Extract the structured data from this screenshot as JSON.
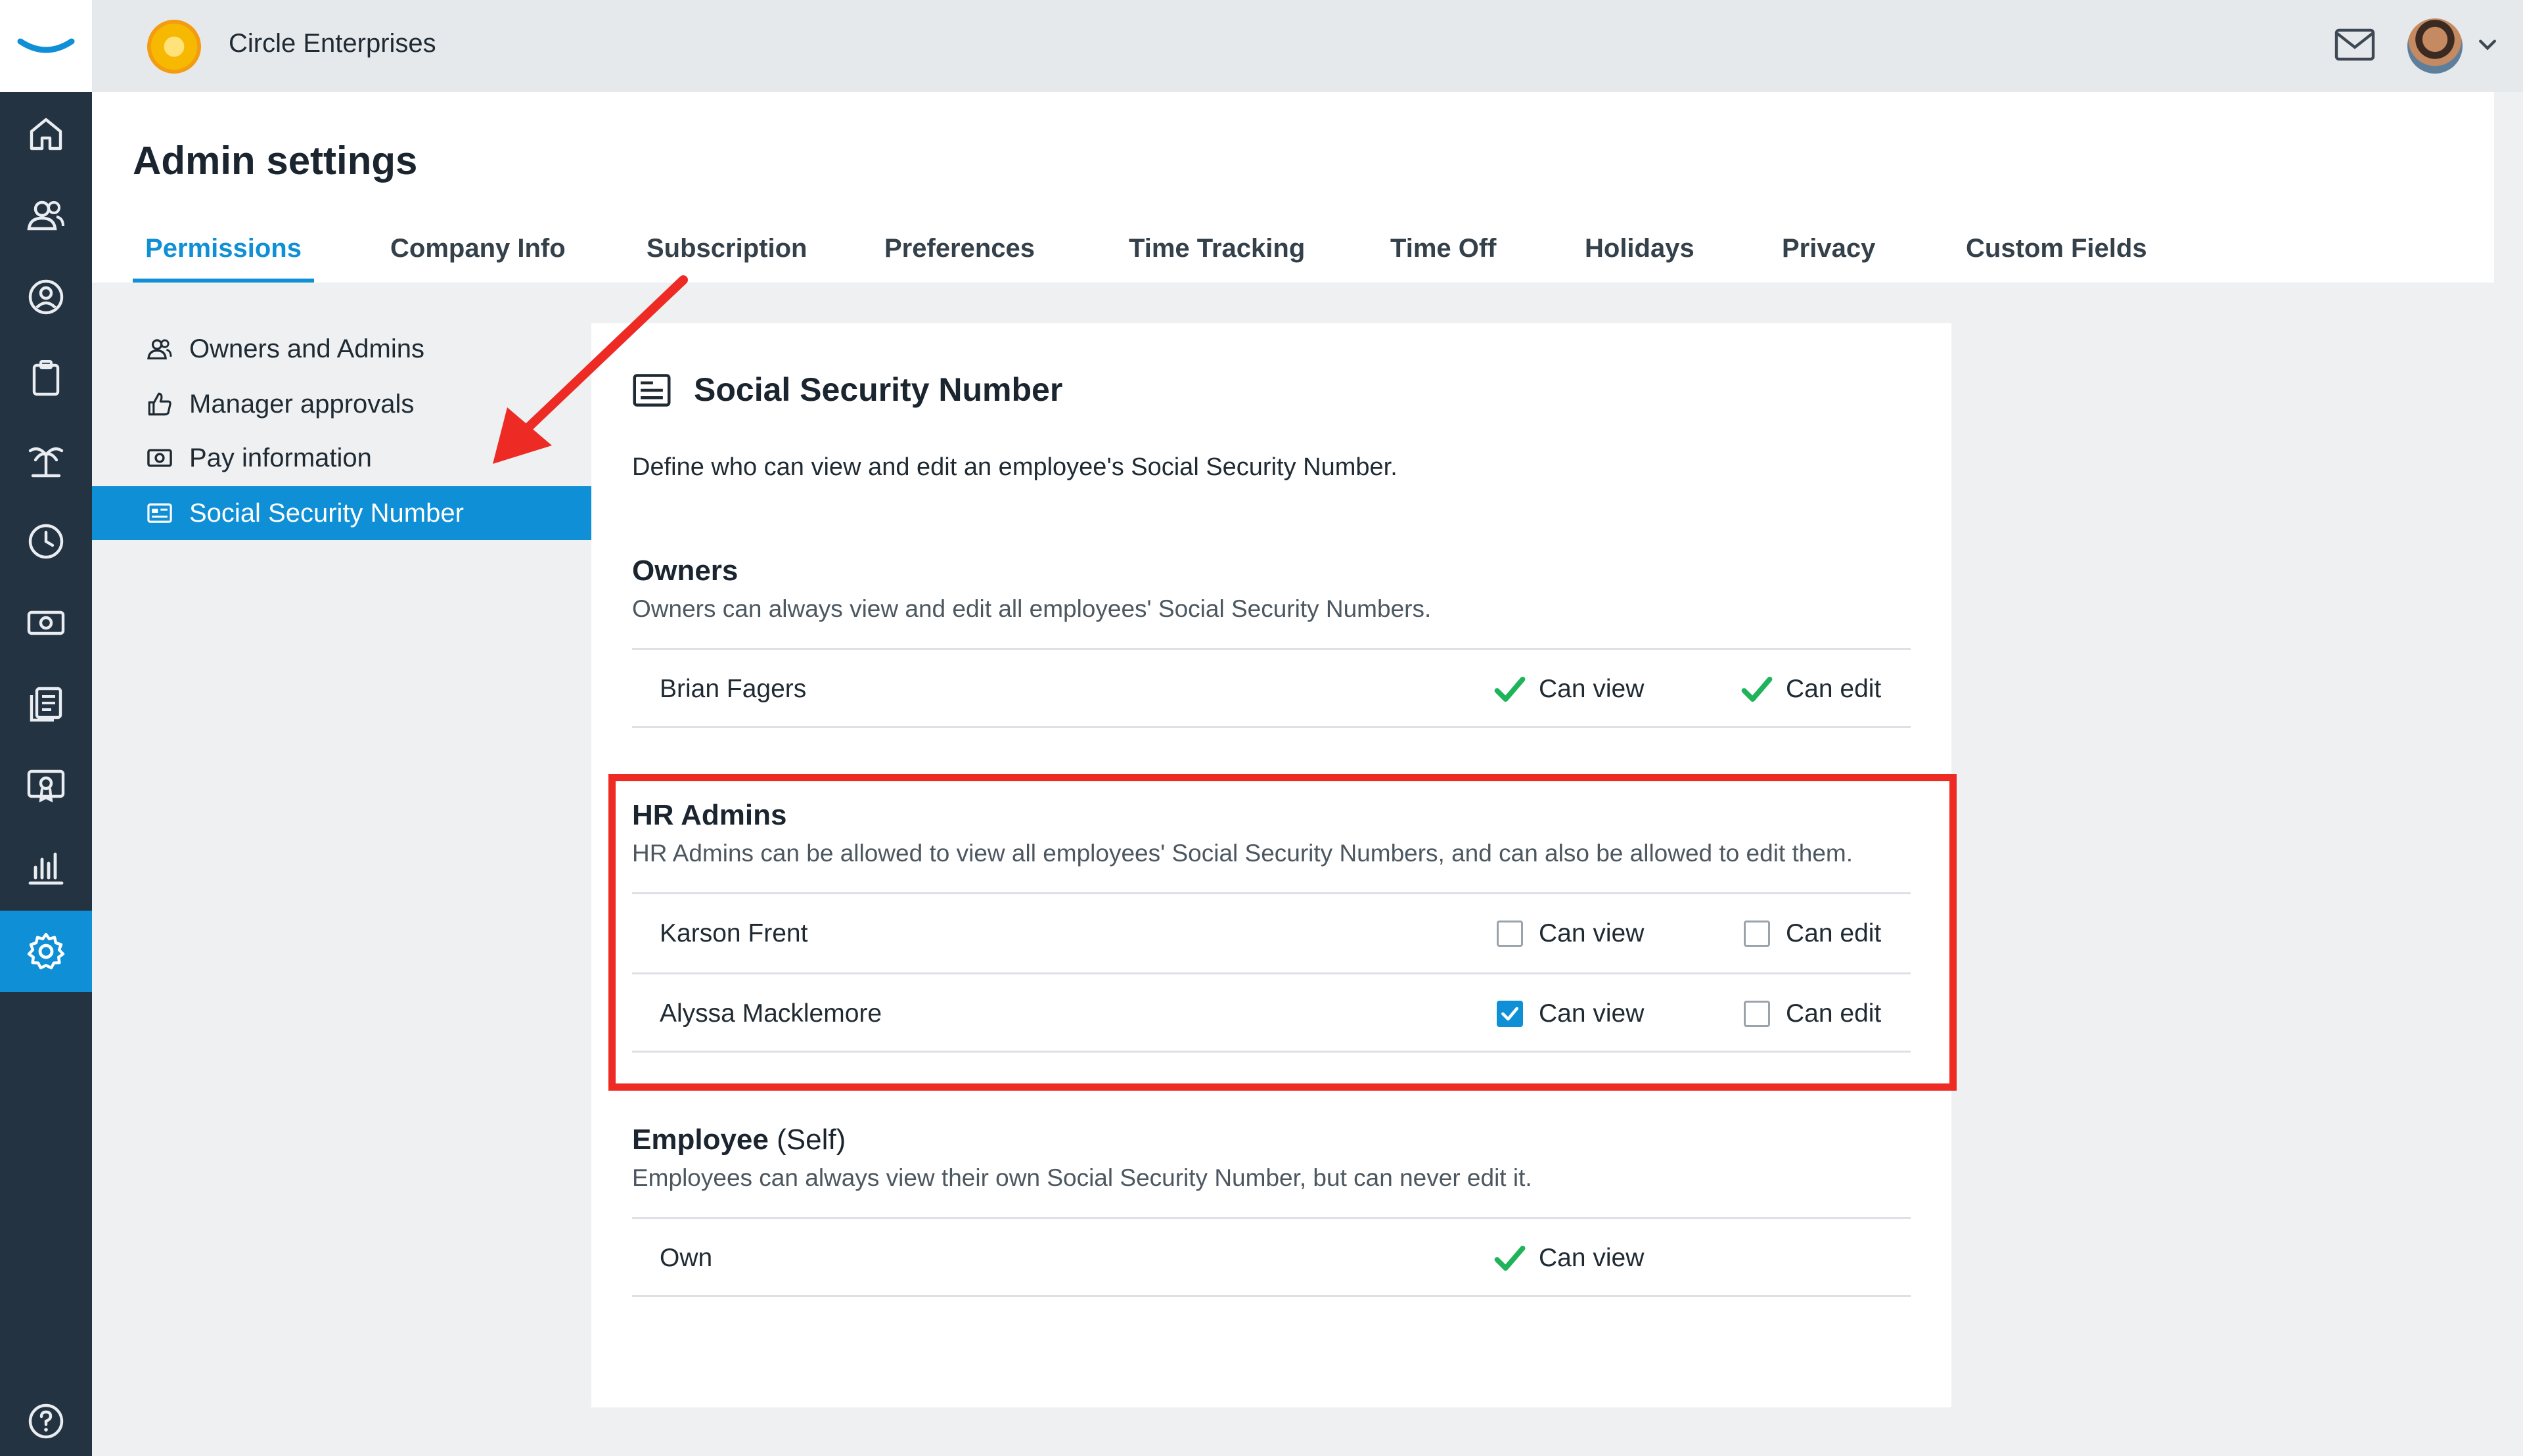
{
  "topbar": {
    "company_name": "Circle Enterprises",
    "mail_icon": "mail-icon",
    "avatar": "user-avatar"
  },
  "rail": {
    "items": [
      "home-icon",
      "people-icon",
      "person-search-icon",
      "clipboard-icon",
      "palm-tree-icon",
      "clock-icon",
      "cash-icon",
      "documents-icon",
      "certificate-icon",
      "bar-chart-icon",
      "settings-icon"
    ],
    "active": "settings-icon",
    "help": "help-icon"
  },
  "header": {
    "title": "Admin settings",
    "tabs": [
      {
        "label": "Permissions",
        "active": true
      },
      {
        "label": "Company Info"
      },
      {
        "label": "Subscription"
      },
      {
        "label": "Preferences"
      },
      {
        "label": "Time Tracking"
      },
      {
        "label": "Time Off"
      },
      {
        "label": "Holidays"
      },
      {
        "label": "Privacy"
      },
      {
        "label": "Custom Fields"
      }
    ]
  },
  "submenu": {
    "items": [
      {
        "label": "Owners and Admins",
        "icon": "people-icon"
      },
      {
        "label": "Manager approvals",
        "icon": "thumbs-up-icon"
      },
      {
        "label": "Pay information",
        "icon": "cash-icon"
      },
      {
        "label": "Social Security Number",
        "icon": "id-card-icon",
        "active": true
      }
    ]
  },
  "card": {
    "title": "Social Security Number",
    "description": "Define who can view and edit an employee's Social Security Number.",
    "owners": {
      "title": "Owners",
      "subtitle": "Owners can always view and edit all employees' Social Security Numbers.",
      "rows": [
        {
          "name": "Brian Fagers",
          "view_label": "Can view",
          "edit_label": "Can edit"
        }
      ]
    },
    "hr_admins": {
      "title": "HR Admins",
      "subtitle": "HR Admins can be allowed to view all employees' Social Security Numbers, and can also be allowed to edit them.",
      "rows": [
        {
          "name": "Karson Frent",
          "view_label": "Can view",
          "view_checked": false,
          "edit_label": "Can edit",
          "edit_checked": false
        },
        {
          "name": "Alyssa Macklemore",
          "view_label": "Can view",
          "view_checked": true,
          "edit_label": "Can edit",
          "edit_checked": false
        }
      ]
    },
    "employee": {
      "title": "Employee",
      "title_suffix": "(Self)",
      "subtitle": "Employees can always view their own Social Security Number, but can never edit it.",
      "rows": [
        {
          "name": "Own",
          "view_label": "Can view"
        }
      ]
    }
  },
  "colors": {
    "accent": "#0f8fd6",
    "rail": "#243342",
    "check_green": "#1fb35a",
    "annotation_red": "#ee2a24"
  }
}
